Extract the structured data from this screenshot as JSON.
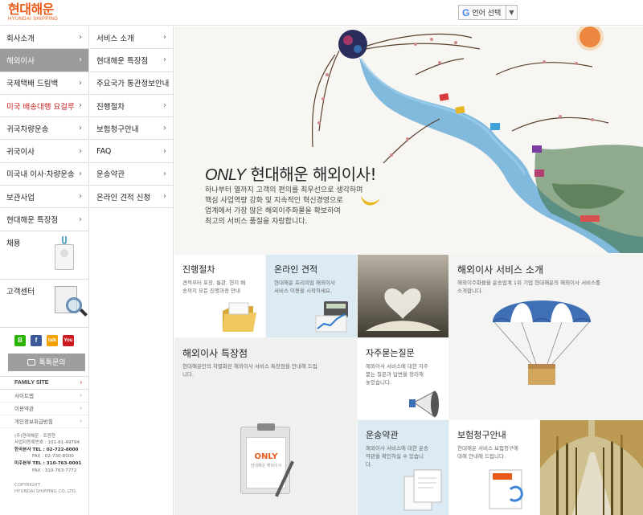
{
  "header": {
    "logo_ko": "현대해운",
    "logo_en": "HYUNDAI SHIPPING",
    "lang_icon": "G",
    "lang_label": "언어 선택",
    "lang_caret": "▼"
  },
  "col1": {
    "items": [
      {
        "label": "회사소개"
      },
      {
        "label": "해외이사"
      },
      {
        "label": "국제택배 드림백"
      },
      {
        "label": "미국 배송대행 요걸루"
      },
      {
        "label": "귀국차량운송"
      },
      {
        "label": "귀국이사"
      },
      {
        "label": "미국내 이사·차량운송"
      },
      {
        "label": "보관사업"
      },
      {
        "label": "현대해운 특장점"
      }
    ],
    "recruit_label": "채용",
    "customer_center_label": "고객센터",
    "social": {
      "blog": "B",
      "facebook": "f",
      "kakao": "talk",
      "youtube": "You"
    },
    "inquiry_label": "톡톡문의",
    "family_site_label": "FAMILY SITE",
    "small_links": [
      "사이트맵",
      "이용약관",
      "개인정보취급방침"
    ],
    "contact": {
      "company": "(주)현대해운 · 조원현",
      "biz_no": "사업자등록번호 : 101-81-49794",
      "hq_label": "한국본사",
      "hq_tel": "TEL : 02-722-8000",
      "hq_fax": "FAX : 02-730-8000",
      "us_label": "미주본부",
      "us_tel": "TEL : 310-763-0001",
      "us_fax": "FAX : 310-763-7772"
    },
    "copyright_1": "COPYRIGHT",
    "copyright_2": "HYUNDAI SHIPPING CO.,LTD."
  },
  "col2": {
    "items": [
      {
        "label": "서비스 소개"
      },
      {
        "label": "현대해운 특장점"
      },
      {
        "label": "주요국가 통관정보안내"
      },
      {
        "label": "진행절차"
      },
      {
        "label": "보험청구안내"
      },
      {
        "label": "FAQ"
      },
      {
        "label": "운송약관"
      },
      {
        "label": "온라인 견적 신청"
      }
    ]
  },
  "hero": {
    "title_en": "ONLY",
    "title_ko": " 현대해운 해외이사!",
    "desc_1": "하나부터 열까지 고객의 편의를 최우선으로 생각하며",
    "desc_2": "핵심 사업역량 강화 및 지속적인 혁신경영으로",
    "desc_3": "업계에서 가장 많은 해외이주화물을 확보하여",
    "desc_4": "최고의 서비스 품질을 자랑합니다."
  },
  "tiles": {
    "process": {
      "title": "진행절차",
      "desc_1": "견적부터 포장, 통관, 현지 배",
      "desc_2": "송까지 모든 진행과정 안내"
    },
    "estimate": {
      "title": "온라인 견적",
      "desc_1": "현대해운 프리미엄 해외이사",
      "desc_2": "서비스 이용을 시작하세요."
    },
    "service": {
      "title": "해외이사 서비스 소개",
      "desc_1": "해외이주화물을 운송업계 1위 기업 현대해운의 해외이사 서비스를",
      "desc_2": "소개합니다."
    },
    "special": {
      "title": "해외이사 특장점",
      "desc_1": "현대해운만의 차별화된 해외이사 서비스 특장점을 안내해 드립",
      "desc_2": "니다.",
      "clip_text": "ONLY",
      "clip_sub": "현대해운 해외이사"
    },
    "faq": {
      "title": "자주묻는질문",
      "desc_1": "해외이사 서비스에 대한 자주",
      "desc_2": "묻는 질문과 답변을 정리해",
      "desc_3": "놓았습니다."
    },
    "terms": {
      "title": "운송약관",
      "desc_1": "해외이사 서비스에 대한 운송",
      "desc_2": "약관을 확인하실 수 있습니",
      "desc_3": "다."
    },
    "insurance": {
      "title": "보험청구안내",
      "desc_1": "현대해운 서비스 보험청구에",
      "desc_2": "대해 안내해 드립니다."
    }
  },
  "colors": {
    "brand": "#e85a1a",
    "active_nav": "#9b9b9b",
    "tile_blue": "#dcebf3",
    "alert_red": "#cc2222"
  }
}
